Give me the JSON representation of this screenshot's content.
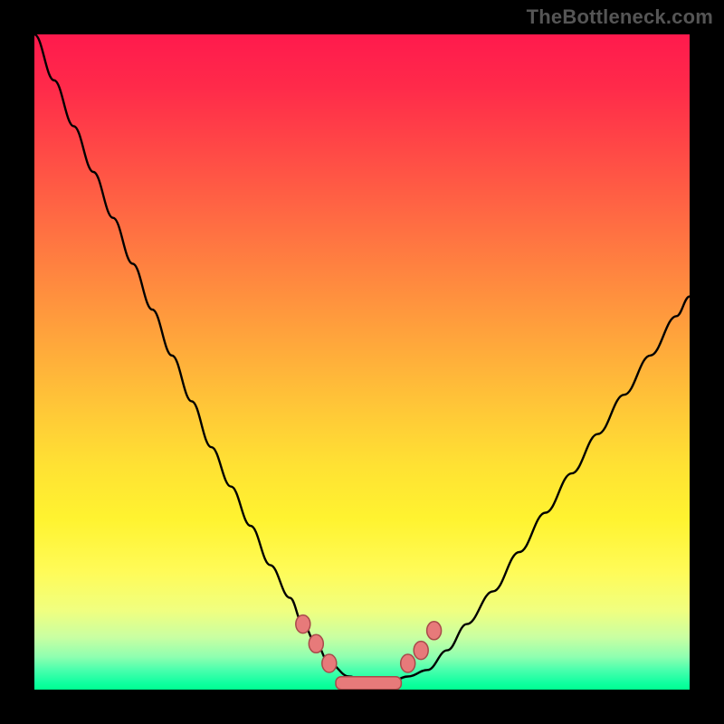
{
  "attribution": "TheBottleneck.com",
  "colors": {
    "frame": "#000000",
    "gradient_top": "#ff1a4d",
    "gradient_bottom": "#00ff91",
    "curve": "#000000",
    "marker_fill": "#e77a7a",
    "marker_stroke": "#a84a4a"
  },
  "chart_data": {
    "type": "line",
    "title": "",
    "xlabel": "",
    "ylabel": "",
    "xlim": [
      0,
      100
    ],
    "ylim": [
      0,
      100
    ],
    "x": [
      0,
      3,
      6,
      9,
      12,
      15,
      18,
      21,
      24,
      27,
      30,
      33,
      36,
      39,
      41,
      43,
      45,
      48,
      51,
      54,
      57,
      60,
      63,
      66,
      70,
      74,
      78,
      82,
      86,
      90,
      94,
      98,
      100
    ],
    "y": [
      100,
      93,
      86,
      79,
      72,
      65,
      58,
      51,
      44,
      37,
      31,
      25,
      19,
      14,
      10,
      7,
      4,
      2,
      1,
      1,
      2,
      3,
      6,
      10,
      15,
      21,
      27,
      33,
      39,
      45,
      51,
      57,
      60
    ],
    "markers_x": [
      41,
      43,
      45,
      57,
      59,
      61
    ],
    "markers_y": [
      10,
      7,
      4,
      4,
      6,
      9
    ],
    "basin": {
      "x_start": 46,
      "x_end": 56,
      "y": 1
    }
  }
}
